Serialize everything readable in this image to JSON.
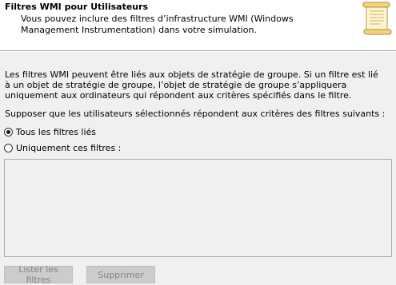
{
  "header": {
    "title": "Filtres WMI pour Utilisateurs",
    "description": "Vous pouvez inclure des filtres d’infrastructure WMI (Windows Management Instrumentation) dans votre simulation.",
    "icon": "scroll-icon"
  },
  "info_text": "Les filtres WMI peuvent être liés aux objets de stratégie de groupe. Si un filtre est lié à un objet de stratégie de groupe, l’objet de stratégie de groupe s’appliquera uniquement aux ordinateurs qui répondent aux critères spécifiés dans le filtre.",
  "prompt_text": "Supposer que les utilisateurs sélectionnés répondent aux critères des filtres suivants :",
  "options": {
    "all_linked": {
      "label": "Tous les filtres liés",
      "checked": true
    },
    "only_these": {
      "label": "Uniquement ces filtres :",
      "checked": false
    }
  },
  "filter_list": [],
  "buttons": {
    "list_label": "Lister les filtres",
    "delete_label": "Supprimer"
  },
  "colors": {
    "header_bg": "#ffffff",
    "window_bg": "#f0f0f0",
    "disabled_button_bg": "#cccccc",
    "disabled_text": "#838383"
  }
}
